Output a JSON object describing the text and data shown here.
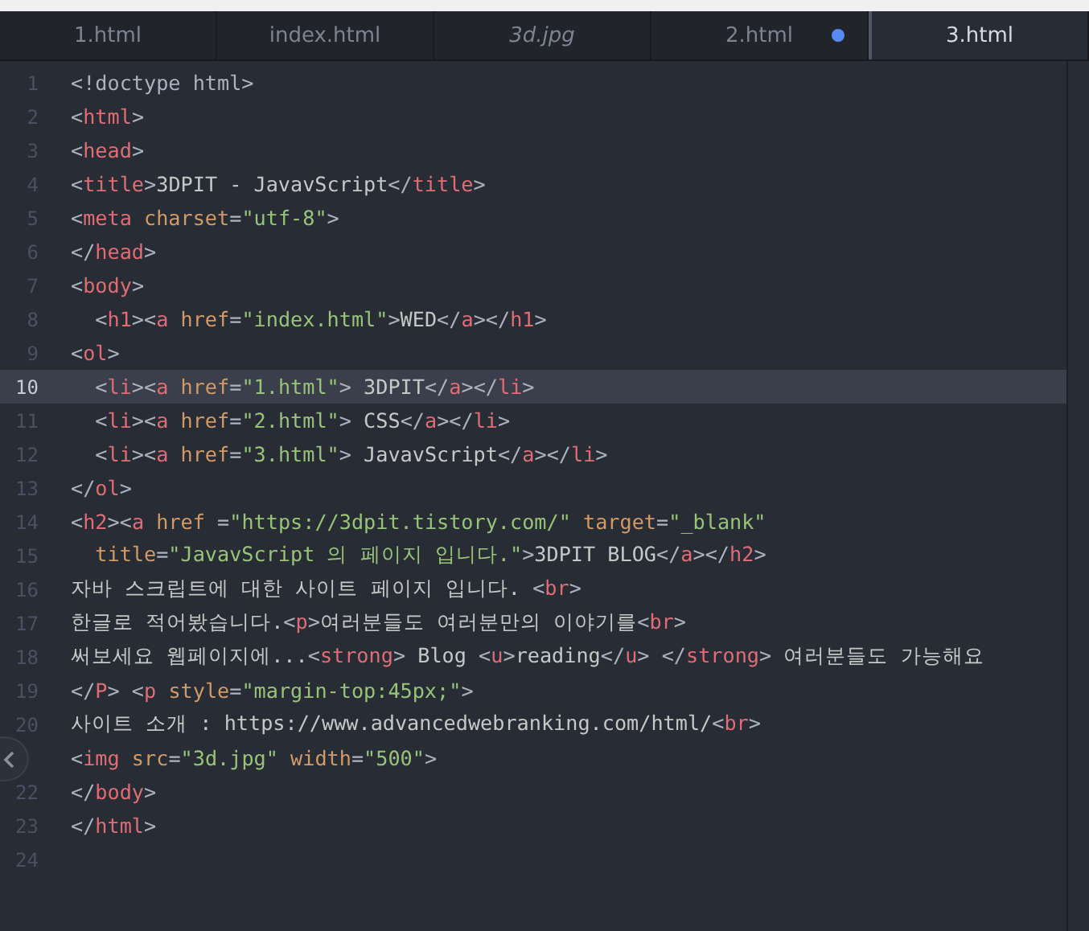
{
  "tabs": [
    {
      "label": "1.html",
      "selected": false,
      "preview": false,
      "modified": false
    },
    {
      "label": "index.html",
      "selected": false,
      "preview": false,
      "modified": false
    },
    {
      "label": "3d.jpg",
      "selected": false,
      "preview": true,
      "modified": false
    },
    {
      "label": "2.html",
      "selected": false,
      "preview": false,
      "modified": true
    },
    {
      "label": "3.html",
      "selected": true,
      "preview": false,
      "modified": false
    }
  ],
  "lines": [
    {
      "number": "1",
      "selected": false,
      "tokens": [
        {
          "kind": "punct",
          "text": "<!doctype html>"
        }
      ]
    },
    {
      "number": "2",
      "selected": false,
      "tokens": [
        {
          "kind": "punct",
          "text": "<"
        },
        {
          "kind": "tag",
          "text": "html"
        },
        {
          "kind": "punct",
          "text": ">"
        }
      ]
    },
    {
      "number": "3",
      "selected": false,
      "tokens": [
        {
          "kind": "punct",
          "text": "<"
        },
        {
          "kind": "tag",
          "text": "head"
        },
        {
          "kind": "punct",
          "text": ">"
        }
      ]
    },
    {
      "number": "4",
      "selected": false,
      "tokens": [
        {
          "kind": "punct",
          "text": "<"
        },
        {
          "kind": "tag",
          "text": "title"
        },
        {
          "kind": "punct",
          "text": ">"
        },
        {
          "kind": "text",
          "text": "3DPIT - JavavScript"
        },
        {
          "kind": "punct",
          "text": "</"
        },
        {
          "kind": "tag",
          "text": "title"
        },
        {
          "kind": "punct",
          "text": ">"
        }
      ]
    },
    {
      "number": "5",
      "selected": false,
      "tokens": [
        {
          "kind": "punct",
          "text": "<"
        },
        {
          "kind": "tag",
          "text": "meta"
        },
        {
          "kind": "attr",
          "text": " charset"
        },
        {
          "kind": "punct",
          "text": "="
        },
        {
          "kind": "string",
          "text": "\"utf-8\""
        },
        {
          "kind": "punct",
          "text": ">"
        }
      ]
    },
    {
      "number": "6",
      "selected": false,
      "tokens": [
        {
          "kind": "punct",
          "text": "</"
        },
        {
          "kind": "tag",
          "text": "head"
        },
        {
          "kind": "punct",
          "text": ">"
        }
      ]
    },
    {
      "number": "7",
      "selected": false,
      "tokens": [
        {
          "kind": "punct",
          "text": "<"
        },
        {
          "kind": "tag",
          "text": "body"
        },
        {
          "kind": "punct",
          "text": ">"
        }
      ]
    },
    {
      "number": "8",
      "selected": false,
      "tokens": [
        {
          "kind": "punct",
          "text": "  <"
        },
        {
          "kind": "tag",
          "text": "h1"
        },
        {
          "kind": "punct",
          "text": "><"
        },
        {
          "kind": "tag",
          "text": "a"
        },
        {
          "kind": "attr",
          "text": " href"
        },
        {
          "kind": "punct",
          "text": "="
        },
        {
          "kind": "string",
          "text": "\"index.html\""
        },
        {
          "kind": "punct",
          "text": ">"
        },
        {
          "kind": "text",
          "text": "WED"
        },
        {
          "kind": "punct",
          "text": "</"
        },
        {
          "kind": "tag",
          "text": "a"
        },
        {
          "kind": "punct",
          "text": "></"
        },
        {
          "kind": "tag",
          "text": "h1"
        },
        {
          "kind": "punct",
          "text": ">"
        }
      ]
    },
    {
      "number": "9",
      "selected": false,
      "tokens": [
        {
          "kind": "punct",
          "text": "<"
        },
        {
          "kind": "tag",
          "text": "ol"
        },
        {
          "kind": "punct",
          "text": ">"
        }
      ]
    },
    {
      "number": "10",
      "selected": true,
      "tokens": [
        {
          "kind": "punct",
          "text": "  <"
        },
        {
          "kind": "tag",
          "text": "li"
        },
        {
          "kind": "punct",
          "text": "><"
        },
        {
          "kind": "tag",
          "text": "a"
        },
        {
          "kind": "attr",
          "text": " href"
        },
        {
          "kind": "punct",
          "text": "="
        },
        {
          "kind": "string",
          "text": "\"1.html\""
        },
        {
          "kind": "punct",
          "text": ">"
        },
        {
          "kind": "text",
          "text": " 3DPIT"
        },
        {
          "kind": "punct",
          "text": "</"
        },
        {
          "kind": "tag",
          "text": "a"
        },
        {
          "kind": "punct",
          "text": "></"
        },
        {
          "kind": "tag",
          "text": "li"
        },
        {
          "kind": "punct",
          "text": ">"
        }
      ]
    },
    {
      "number": "11",
      "selected": false,
      "tokens": [
        {
          "kind": "punct",
          "text": "  <"
        },
        {
          "kind": "tag",
          "text": "li"
        },
        {
          "kind": "punct",
          "text": "><"
        },
        {
          "kind": "tag",
          "text": "a"
        },
        {
          "kind": "attr",
          "text": " href"
        },
        {
          "kind": "punct",
          "text": "="
        },
        {
          "kind": "string",
          "text": "\"2.html\""
        },
        {
          "kind": "punct",
          "text": ">"
        },
        {
          "kind": "text",
          "text": " CSS"
        },
        {
          "kind": "punct",
          "text": "</"
        },
        {
          "kind": "tag",
          "text": "a"
        },
        {
          "kind": "punct",
          "text": "></"
        },
        {
          "kind": "tag",
          "text": "li"
        },
        {
          "kind": "punct",
          "text": ">"
        }
      ]
    },
    {
      "number": "12",
      "selected": false,
      "tokens": [
        {
          "kind": "punct",
          "text": "  <"
        },
        {
          "kind": "tag",
          "text": "li"
        },
        {
          "kind": "punct",
          "text": "><"
        },
        {
          "kind": "tag",
          "text": "a"
        },
        {
          "kind": "attr",
          "text": " href"
        },
        {
          "kind": "punct",
          "text": "="
        },
        {
          "kind": "string",
          "text": "\"3.html\""
        },
        {
          "kind": "punct",
          "text": ">"
        },
        {
          "kind": "text",
          "text": " JavavScript"
        },
        {
          "kind": "punct",
          "text": "</"
        },
        {
          "kind": "tag",
          "text": "a"
        },
        {
          "kind": "punct",
          "text": "></"
        },
        {
          "kind": "tag",
          "text": "li"
        },
        {
          "kind": "punct",
          "text": ">"
        }
      ]
    },
    {
      "number": "13",
      "selected": false,
      "tokens": [
        {
          "kind": "punct",
          "text": "</"
        },
        {
          "kind": "tag",
          "text": "ol"
        },
        {
          "kind": "punct",
          "text": ">"
        }
      ]
    },
    {
      "number": "14",
      "selected": false,
      "tokens": [
        {
          "kind": "punct",
          "text": "<"
        },
        {
          "kind": "tag",
          "text": "h2"
        },
        {
          "kind": "punct",
          "text": "><"
        },
        {
          "kind": "tag",
          "text": "a"
        },
        {
          "kind": "attr",
          "text": " href"
        },
        {
          "kind": "punct",
          "text": " ="
        },
        {
          "kind": "string",
          "text": "\"https://3dpit.tistory.com/\""
        },
        {
          "kind": "attr",
          "text": " target"
        },
        {
          "kind": "punct",
          "text": "="
        },
        {
          "kind": "string",
          "text": "\"_blank\""
        }
      ]
    },
    {
      "number": "15",
      "selected": false,
      "tokens": [
        {
          "kind": "attr",
          "text": "  title"
        },
        {
          "kind": "punct",
          "text": "="
        },
        {
          "kind": "string",
          "text": "\"JavavScript 의 페이지 입니다.\""
        },
        {
          "kind": "punct",
          "text": ">"
        },
        {
          "kind": "text",
          "text": "3DPIT BLOG"
        },
        {
          "kind": "punct",
          "text": "</"
        },
        {
          "kind": "tag",
          "text": "a"
        },
        {
          "kind": "punct",
          "text": "></"
        },
        {
          "kind": "tag",
          "text": "h2"
        },
        {
          "kind": "punct",
          "text": ">"
        }
      ]
    },
    {
      "number": "16",
      "selected": false,
      "tokens": [
        {
          "kind": "text",
          "text": "자바 스크립트에 대한 사이트 페이지 입니다. "
        },
        {
          "kind": "punct",
          "text": "<"
        },
        {
          "kind": "tag",
          "text": "br"
        },
        {
          "kind": "punct",
          "text": ">"
        }
      ]
    },
    {
      "number": "17",
      "selected": false,
      "tokens": [
        {
          "kind": "text",
          "text": "한글로 적어봤습니다."
        },
        {
          "kind": "punct",
          "text": "<"
        },
        {
          "kind": "tag",
          "text": "p"
        },
        {
          "kind": "punct",
          "text": ">"
        },
        {
          "kind": "text",
          "text": "여러분들도 여러분만의 이야기를"
        },
        {
          "kind": "punct",
          "text": "<"
        },
        {
          "kind": "tag",
          "text": "br"
        },
        {
          "kind": "punct",
          "text": ">"
        }
      ]
    },
    {
      "number": "18",
      "selected": false,
      "tokens": [
        {
          "kind": "text",
          "text": "써보세요 웹페이지에..."
        },
        {
          "kind": "punct",
          "text": "<"
        },
        {
          "kind": "tag",
          "text": "strong"
        },
        {
          "kind": "punct",
          "text": ">"
        },
        {
          "kind": "text",
          "text": " Blog "
        },
        {
          "kind": "punct",
          "text": "<"
        },
        {
          "kind": "tag",
          "text": "u"
        },
        {
          "kind": "punct",
          "text": ">"
        },
        {
          "kind": "text",
          "text": "reading"
        },
        {
          "kind": "punct",
          "text": "</"
        },
        {
          "kind": "tag",
          "text": "u"
        },
        {
          "kind": "punct",
          "text": "> </"
        },
        {
          "kind": "tag",
          "text": "strong"
        },
        {
          "kind": "punct",
          "text": ">"
        },
        {
          "kind": "text",
          "text": " 여러분들도 가능해요"
        }
      ]
    },
    {
      "number": "19",
      "selected": false,
      "tokens": [
        {
          "kind": "punct",
          "text": "</"
        },
        {
          "kind": "tag",
          "text": "P"
        },
        {
          "kind": "punct",
          "text": "> <"
        },
        {
          "kind": "tag",
          "text": "p"
        },
        {
          "kind": "attr",
          "text": " style"
        },
        {
          "kind": "punct",
          "text": "="
        },
        {
          "kind": "string",
          "text": "\"margin-top:45px;\""
        },
        {
          "kind": "punct",
          "text": ">"
        }
      ]
    },
    {
      "number": "20",
      "selected": false,
      "tokens": [
        {
          "kind": "text",
          "text": "사이트 소개 : https://www.advancedwebranking.com/html/"
        },
        {
          "kind": "punct",
          "text": "<"
        },
        {
          "kind": "tag",
          "text": "br"
        },
        {
          "kind": "punct",
          "text": ">"
        }
      ]
    },
    {
      "selected": false,
      "tokens": [
        {
          "kind": "punct",
          "text": "<"
        },
        {
          "kind": "tag",
          "text": "img"
        },
        {
          "kind": "attr",
          "text": " src"
        },
        {
          "kind": "punct",
          "text": "="
        },
        {
          "kind": "string",
          "text": "\"3d.jpg\""
        },
        {
          "kind": "attr",
          "text": " width"
        },
        {
          "kind": "punct",
          "text": "="
        },
        {
          "kind": "string",
          "text": "\"500\""
        },
        {
          "kind": "punct",
          "text": ">"
        }
      ]
    },
    {
      "number": "22",
      "selected": false,
      "tokens": [
        {
          "kind": "punct",
          "text": "</"
        },
        {
          "kind": "tag",
          "text": "body"
        },
        {
          "kind": "punct",
          "text": ">"
        }
      ]
    },
    {
      "number": "23",
      "selected": false,
      "tokens": [
        {
          "kind": "punct",
          "text": "</"
        },
        {
          "kind": "tag",
          "text": "html"
        },
        {
          "kind": "punct",
          "text": ">"
        }
      ]
    },
    {
      "number": "24",
      "selected": false
    }
  ]
}
